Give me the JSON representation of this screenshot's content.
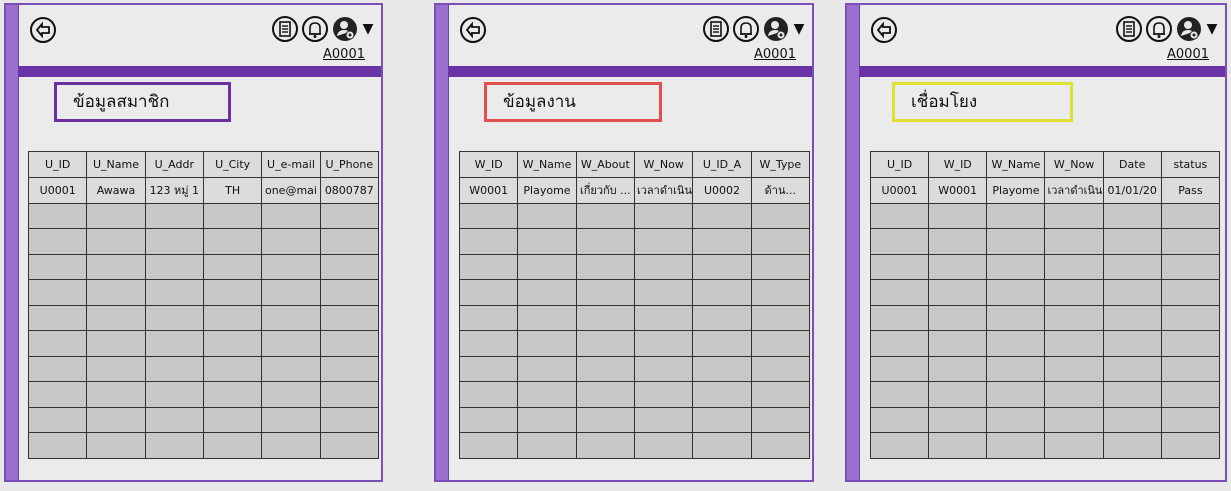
{
  "header": {
    "user_code": "A0001"
  },
  "colors": {
    "accent": "#6a34a6",
    "sidebar": "#9a6fcf",
    "border_member": "#6b2fa0",
    "border_work": "#e05050",
    "border_link": "#e0e030"
  },
  "icons": [
    "back-icon",
    "document-icon",
    "bell-icon",
    "user-settings-icon",
    "caret-down-icon"
  ],
  "panels": [
    {
      "title": "ข้อมูลสมาชิก",
      "columns": [
        "U_ID",
        "U_Name",
        "U_Addr",
        "U_City",
        "U_e-mail",
        "U_Phone"
      ],
      "row": [
        "U0001",
        "Awawa",
        "123 หมู่ 1",
        "TH",
        "one@mai",
        "0800787"
      ]
    },
    {
      "title": "ข้อมูลงาน",
      "columns": [
        "W_ID",
        "W_Name",
        "W_About",
        "W_Now",
        "U_ID_A",
        "W_Type"
      ],
      "row": [
        "W0001",
        "Playome",
        "เกี่ยวกับ ...",
        "เวลาดำเนิน",
        "U0002",
        "ด้าน..."
      ]
    },
    {
      "title": "เชื่อมโยง",
      "columns": [
        "U_ID",
        "W_ID",
        "W_Name",
        "W_Now",
        "Date",
        "status"
      ],
      "row": [
        "U0001",
        "W0001",
        "Playome",
        "เวลาดำเนิน",
        "01/01/20",
        "Pass"
      ]
    }
  ]
}
